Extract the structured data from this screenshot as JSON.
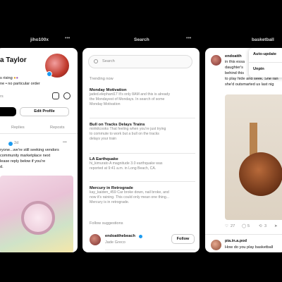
{
  "columns": {
    "col1": {
      "title": "jiho100x",
      "more_icon": "more-icon"
    },
    "col2": {
      "title": "Search",
      "more_icon": "more-icon"
    },
    "col3": {
      "title": "basketball",
      "more_icon": "more-icon"
    }
  },
  "profile": {
    "name": "a Taylor",
    "bio_line1": "s rising",
    "bio_line2": "ne • no particular order",
    "followers": "rs",
    "edit_profile_label": "Edit Profile",
    "tabs": [
      "Replies",
      "Reposts"
    ],
    "post": {
      "time": "2d",
      "text_line1": "ryone...we're still seeking vendors",
      "text_line2": "community marketplace next",
      "text_line3": "lease reply below if you're",
      "text_line4": "d."
    }
  },
  "search": {
    "placeholder": "Search",
    "trending_label": "Trending now",
    "trends": [
      {
        "title": "Monday Motivation",
        "line1": "jaded.elephant17 It's only 8AM and this is already",
        "line2": "the Mondayest of Mondays. In search of some",
        "line3": "Monday Motivation"
      },
      {
        "title": "Bull on Tracks Delays Trains",
        "line1": "mirikitcooks That feeling when you're just trying",
        "line2": "to commute to work but a bull on the tracks",
        "line3": "delays your train"
      },
      {
        "title": "LA Earthquake",
        "line1": "hi_kimurato A magnitude 3.0 earthquake was",
        "line2": "reported at 9:41 a.m. in Long Beach, CA.",
        "line3": ""
      },
      {
        "title": "Mercury in Retrograde",
        "line1": "kay_kaiden_459 Car broke down, nail broke, and",
        "line2": "now it's raining. This could only mean one thing...",
        "line3": "Mercury is in retrograde."
      }
    ],
    "follow_suggestions_label": "Follow suggestions",
    "suggestion": {
      "username": "endoatthebeach",
      "name": "Jade Greco",
      "follow_label": "Follow"
    }
  },
  "feed": {
    "username": "endoatth",
    "text_line1": "in this essa",
    "text_line2": "daughter's",
    "text_line3": "behind this",
    "text_line4": "to play hide and seek. She ran",
    "text_line5": "she'd outsmarted us last nig",
    "menu_items": [
      "Auto-update",
      "Unpin"
    ],
    "actions": {
      "likes": "27",
      "replies": "5",
      "reposts": "3"
    },
    "next_post": {
      "username": "pia.in.a.pod",
      "text": "How do you play basketball"
    }
  },
  "colors": {
    "accent_blue": "#1d9bf0",
    "panel_bg": "#ffffff",
    "backdrop": "#000000"
  }
}
